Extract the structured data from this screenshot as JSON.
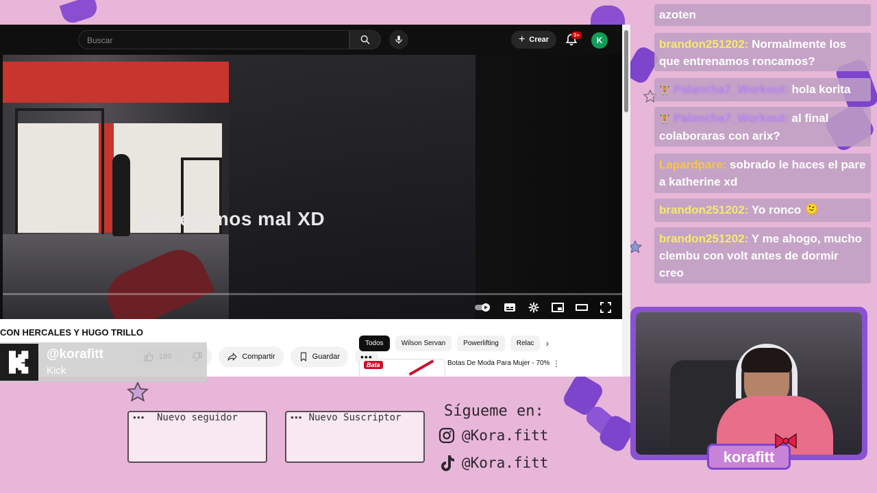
{
  "youtube": {
    "search_placeholder": "Buscar",
    "create_label": "Crear",
    "notification_count": "9+",
    "account_initial": "K",
    "subtitle_text": "Empezamos mal XD",
    "video_title": "CON HERCALES Y HUGO TRILLO",
    "likes": "189",
    "share_label": "Compartir",
    "save_label": "Guardar",
    "chips": [
      "Todos",
      "Wilson Servan",
      "Powerlifting",
      "Relac"
    ],
    "rec_title": "Botas De Moda Para Mujer - 70%",
    "rec_brand": "Bata"
  },
  "kick": {
    "handle": "@korafitt",
    "label": "Kick"
  },
  "alerts": {
    "follower": "Nuevo seguidor",
    "subscriber": "Nuevo Suscriptor"
  },
  "socials": {
    "title": "Sígueme en:",
    "instagram": "@Kora.fitt",
    "tiktok": "@Kora.fitt"
  },
  "chat": {
    "partial_top": "azoten",
    "messages": [
      {
        "user": "brandon251202:",
        "text": "Normalmente los que entrenamos roncamos?"
      },
      {
        "user": "Palancha7_Workout:",
        "text": "hola korita"
      },
      {
        "user": "Palancha7_Workout:",
        "text": "al final colaboraras con arix?"
      },
      {
        "user": "Lapardpare:",
        "text": "sobrado le haces el pare a katherine xd"
      },
      {
        "user": "brandon251202:",
        "text": "Yo ronco 🫠"
      },
      {
        "user": "brandon251202:",
        "text": "Y me ahogo, mucho clembu con volt antes de dormir creo"
      }
    ]
  },
  "webcam": {
    "label": "korafitt"
  }
}
